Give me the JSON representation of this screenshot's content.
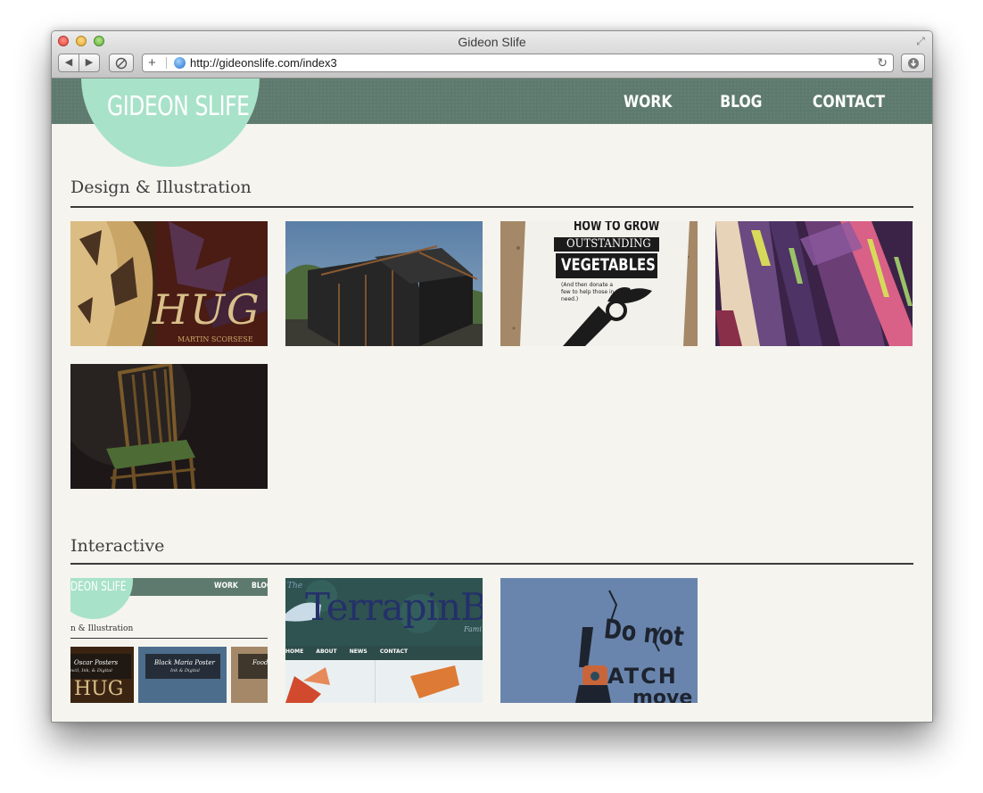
{
  "window": {
    "title": "Gideon Slife"
  },
  "toolbar": {
    "url": "http://gideonslife.com/index3"
  },
  "site": {
    "logo": "GIDEON SLIFE",
    "nav": [
      "WORK",
      "BLOG",
      "CONTACT"
    ]
  },
  "sections": [
    {
      "title": "Design & Illustration"
    },
    {
      "title": "Interactive"
    }
  ],
  "thumbs": {
    "hugo": "HUG",
    "hugo_sub": "MARTIN SCORSESE",
    "veg_line1": "HOW TO GROW",
    "veg_line2": "OUTSTANDING",
    "veg_line3": "VEGETABLES",
    "veg_note": "(And then donate a few to help those in need.)",
    "site_logo": "DEON SLIFE",
    "site_nav_work": "WORK",
    "site_nav_blog": "BLOG",
    "site_section": "n & Illustration",
    "site_card1_title": "Oscar Posters",
    "site_card1_sub": "ncil, Ink, & Digital",
    "site_card2_title": "Black Maria Poster",
    "site_card2_sub": "Ink & Digital",
    "site_card3_title": "Food",
    "site_hug": "HUG",
    "terrapin_the": "The",
    "terrapin_name": "TerrapinB",
    "terrapin_fam": "Fami",
    "terrapin_nav": [
      "HOME",
      "ABOUT",
      "NEWS",
      "CONTACT"
    ],
    "catch_line1": "Do not",
    "catch_line2": "ATCH",
    "catch_line3": "move"
  }
}
